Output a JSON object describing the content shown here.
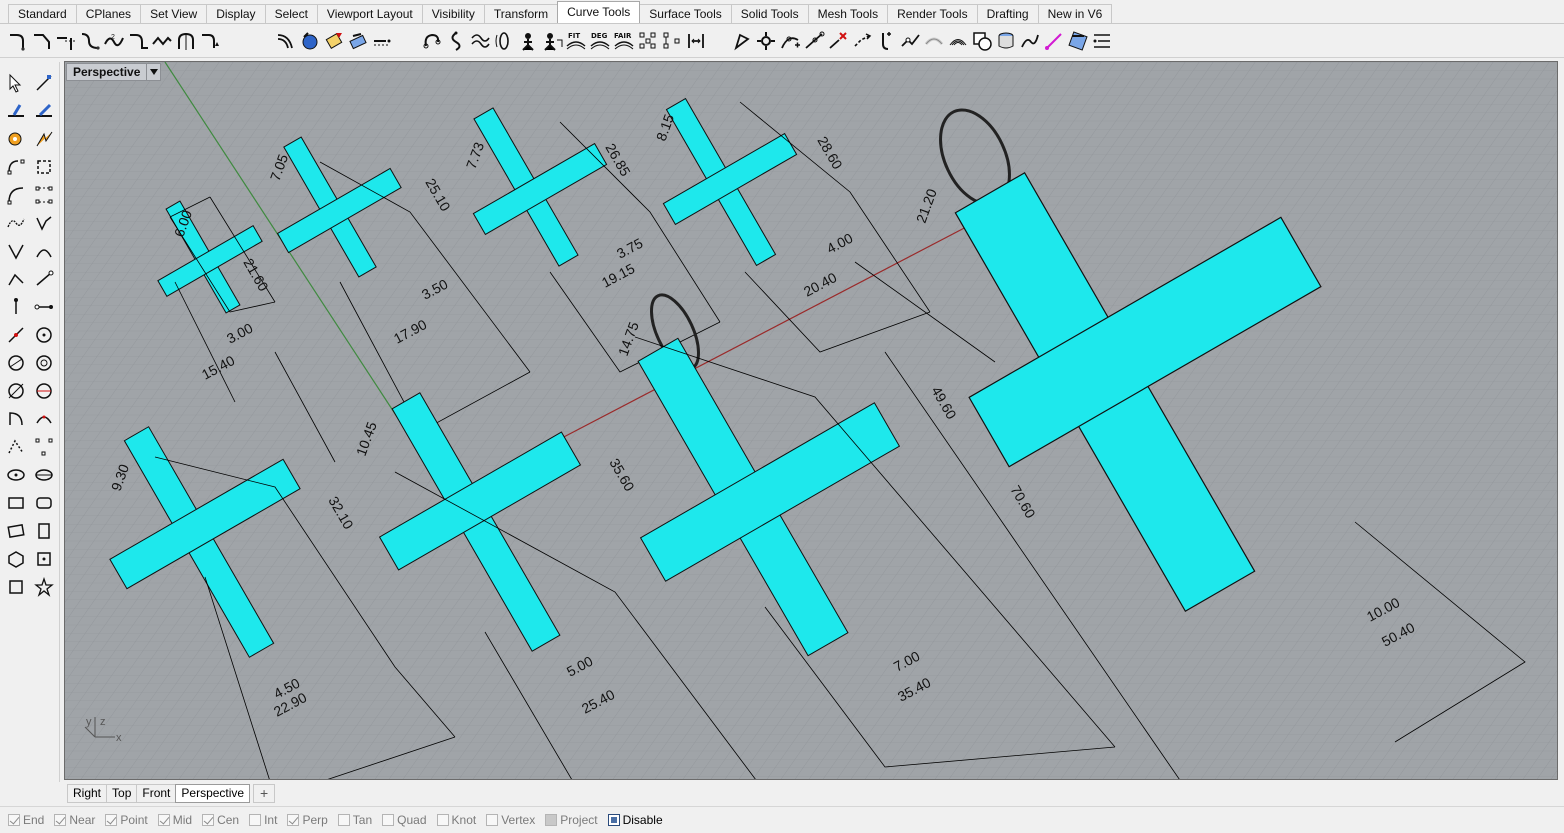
{
  "tabs": [
    {
      "label": "Standard"
    },
    {
      "label": "CPlanes"
    },
    {
      "label": "Set View"
    },
    {
      "label": "Display"
    },
    {
      "label": "Select"
    },
    {
      "label": "Viewport Layout"
    },
    {
      "label": "Visibility"
    },
    {
      "label": "Transform"
    },
    {
      "label": "Curve Tools",
      "active": true
    },
    {
      "label": "Surface Tools"
    },
    {
      "label": "Solid Tools"
    },
    {
      "label": "Mesh Tools"
    },
    {
      "label": "Render Tools"
    },
    {
      "label": "Drafting"
    },
    {
      "label": "New in V6"
    }
  ],
  "toolbar_text_icons": {
    "fit": "FIT",
    "deg": "DEG",
    "fair": "FAIR"
  },
  "viewport": {
    "title": "Perspective",
    "background": "#a0a4a8",
    "axis_labels": {
      "y": "y",
      "z": "z",
      "x": "x"
    },
    "dimensions": {
      "c1": {
        "top_width": "6.00",
        "height": "21.60",
        "arm_width": "3.00",
        "total_width": "15.40"
      },
      "c2": {
        "top_width": "7.05",
        "height": "25.10",
        "arm_width": "3.50",
        "total_width": "17.90"
      },
      "c3": {
        "top_width": "7.73",
        "height": "26.85",
        "arm_width": "3.75",
        "total_width": "19.15"
      },
      "c4": {
        "top_width": "8.15",
        "height": "28.60",
        "arm_width": "4.00",
        "total_width": "20.40"
      },
      "c5": {
        "top_width": "21.20"
      },
      "c6": {
        "top_width": "9.30",
        "height": "32.10",
        "arm_width": "4.50",
        "total_width": "22.90"
      },
      "c7": {
        "top_width": "10.45",
        "height": "35.60",
        "arm_width": "5.00",
        "total_width": "25.40"
      },
      "c8": {
        "top_width": "14.75",
        "height": "49.60",
        "arm_width": "7.00",
        "total_width": "35.40"
      },
      "c9": {
        "height": "70.60",
        "arm_width": "10.00",
        "total_width": "50.40"
      }
    },
    "colors": {
      "gem": "#1ee8ec",
      "dimension": "#000000",
      "grid": "#8f9398"
    }
  },
  "viewport_tabs": [
    {
      "label": "Right"
    },
    {
      "label": "Top"
    },
    {
      "label": "Front"
    },
    {
      "label": "Perspective",
      "active": true
    }
  ],
  "add_viewport_symbol": "+",
  "osnaps": [
    {
      "label": "End",
      "checked": true
    },
    {
      "label": "Near",
      "checked": true
    },
    {
      "label": "Point",
      "checked": true
    },
    {
      "label": "Mid",
      "checked": true
    },
    {
      "label": "Cen",
      "checked": true
    },
    {
      "label": "Int",
      "checked": false
    },
    {
      "label": "Perp",
      "checked": true
    },
    {
      "label": "Tan",
      "checked": false
    },
    {
      "label": "Quad",
      "checked": false
    },
    {
      "label": "Knot",
      "checked": false
    },
    {
      "label": "Vertex",
      "checked": false
    },
    {
      "label": "Project",
      "checked": false
    },
    {
      "label": "Disable",
      "checked": false
    }
  ]
}
